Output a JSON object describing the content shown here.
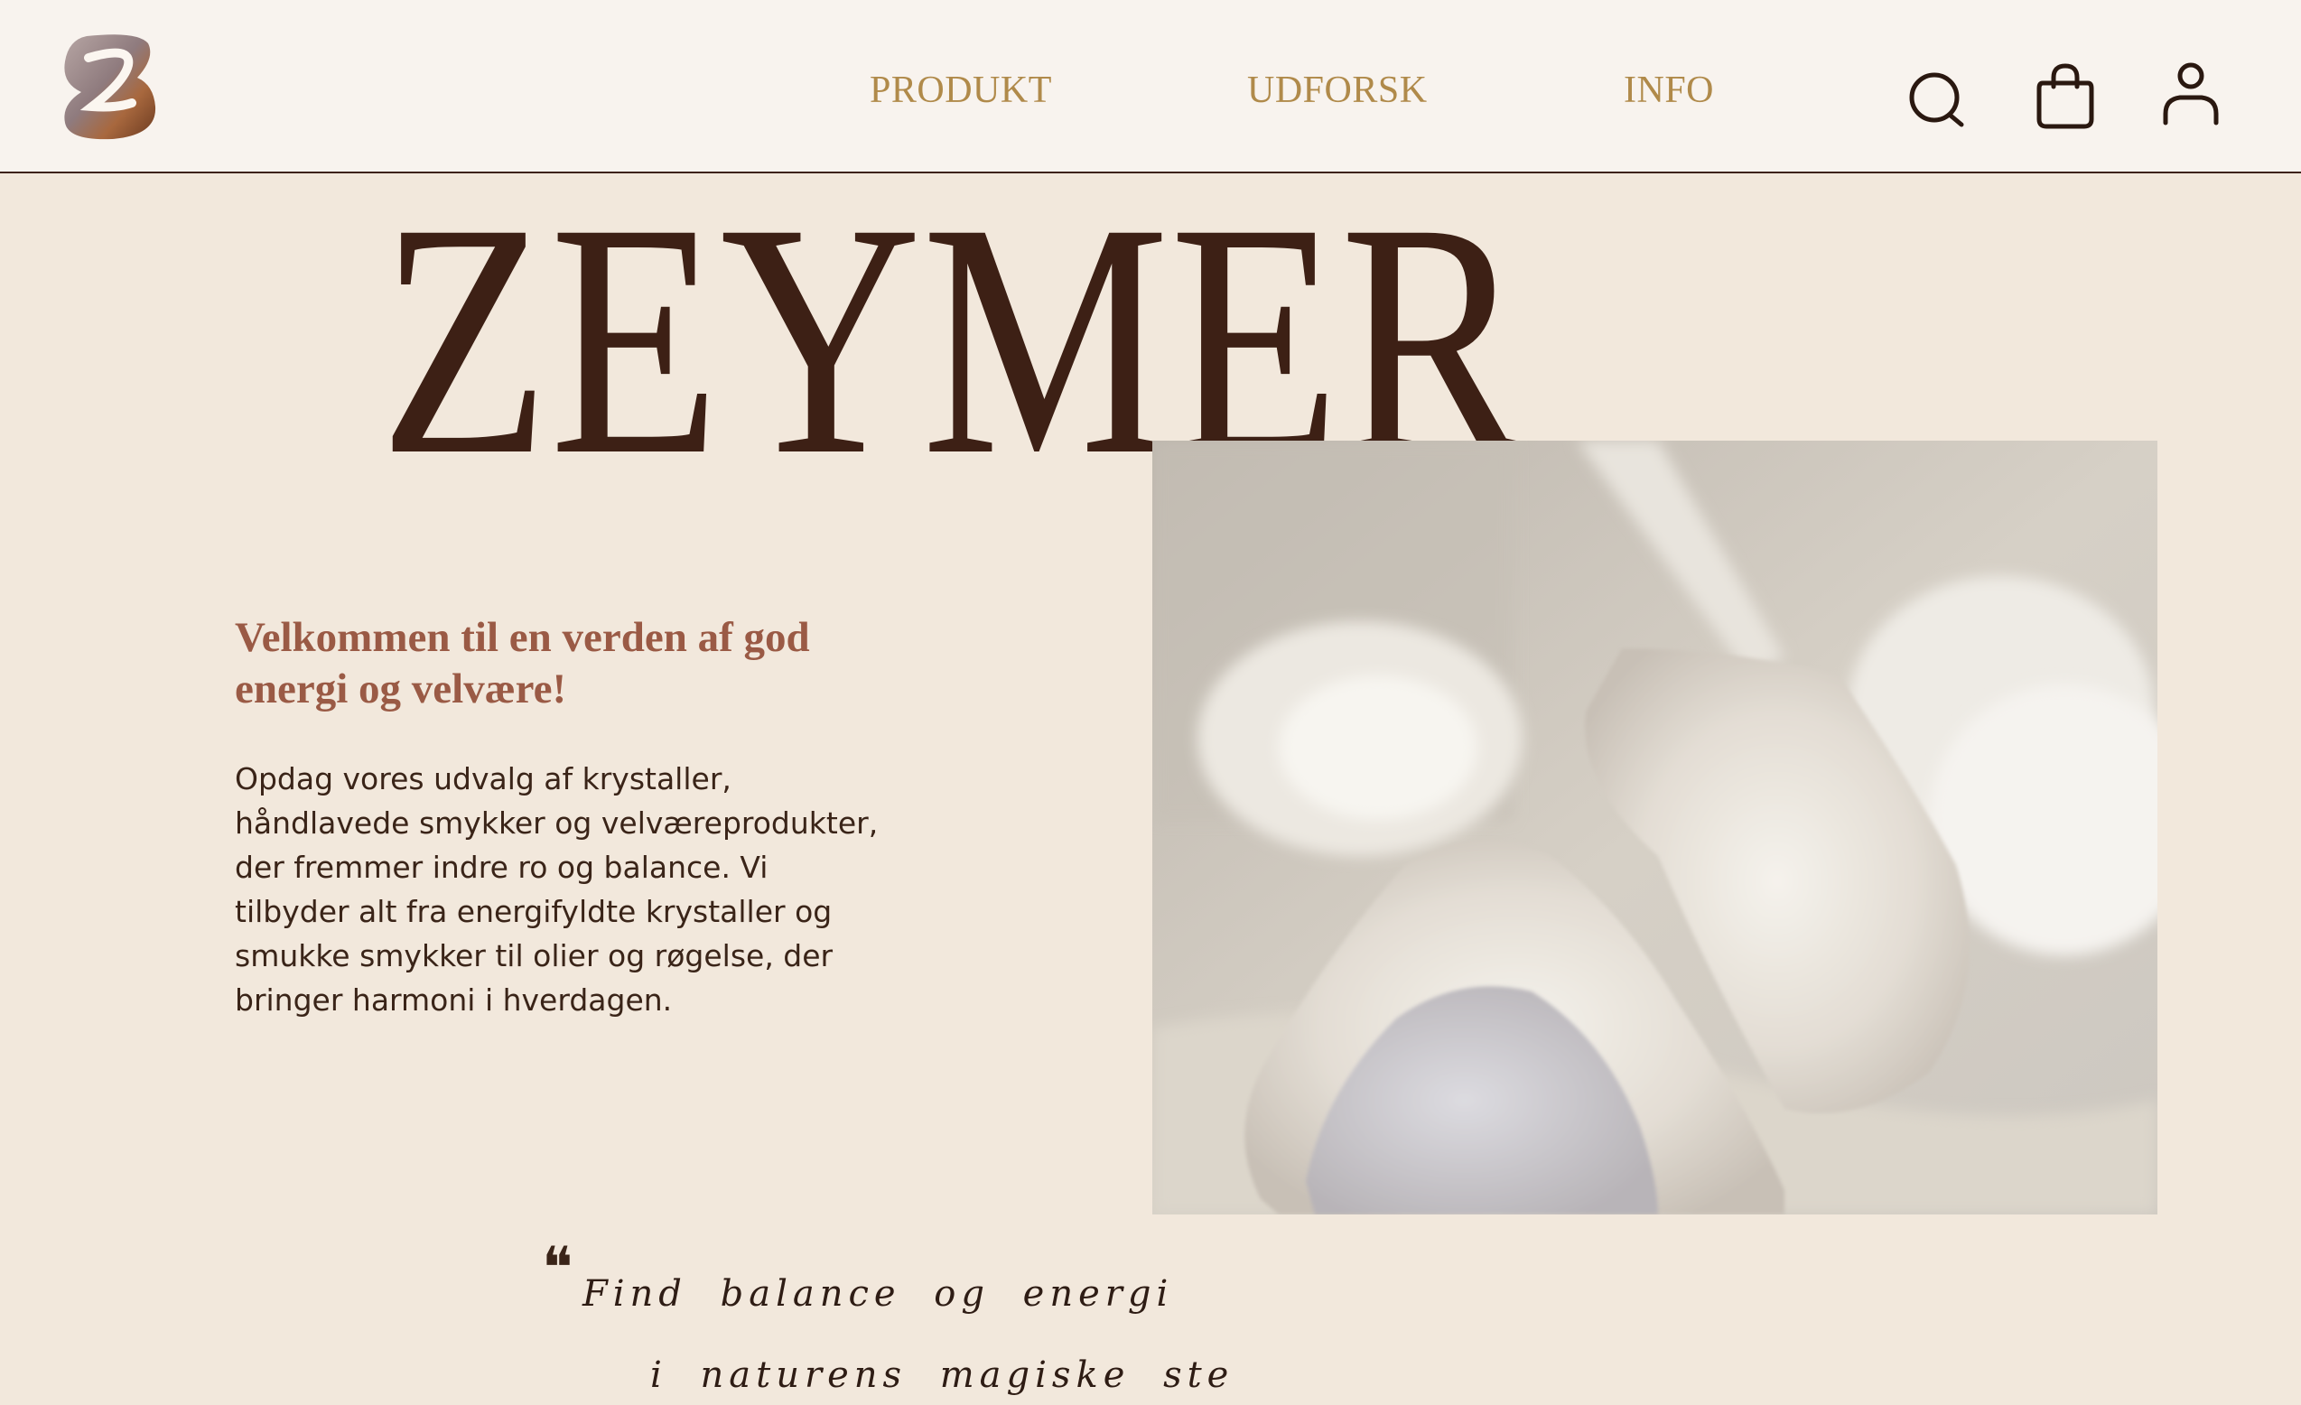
{
  "header": {
    "brand": "ZEYMER",
    "nav": [
      "PRODUKT",
      "UDFORSK",
      "INFO"
    ],
    "icons": [
      "search-icon",
      "shopping-bag-icon",
      "user-icon"
    ]
  },
  "hero": {
    "welcome": "Velkommen til en verden af god energi og velvære!",
    "description": "Opdag vores udvalg af krystaller, håndlavede smykker og velværeprodukter, der fremmer indre ro og balance. Vi tilbyder alt fra energifyldte krystaller og smukke smykker til olier og røgelse, der bringer harmoni i hverdagen.",
    "quote_line1": "Find balance og energi",
    "quote_line2": "i naturens magiske ste"
  },
  "colors": {
    "background": "#f2e8dc",
    "header": "#f8f3ee",
    "brand_dark": "#3d2015",
    "nav_gold": "#b08a4a",
    "welcome": "#9a5a45"
  }
}
